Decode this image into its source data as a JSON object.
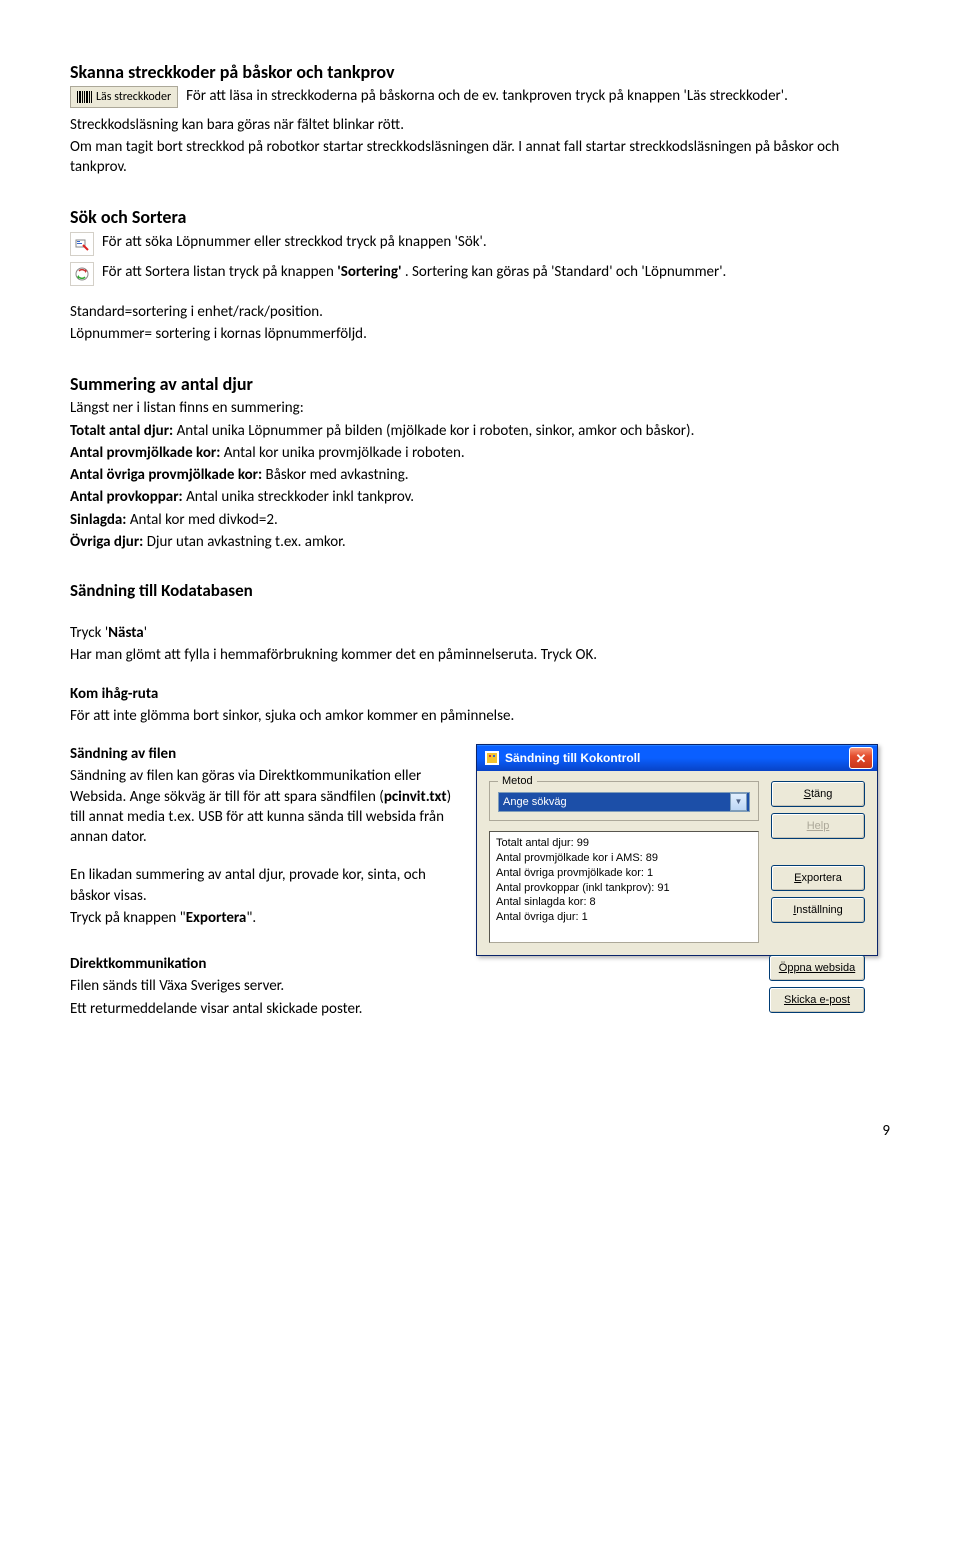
{
  "s1": {
    "title": "Skanna streckkoder på båskor och tankprov",
    "btn_label": "Läs streckkoder",
    "p1": "För att läsa in streckkoderna på båskorna och de ev. tankproven tryck på knappen 'Läs streckkoder'.",
    "p2": "Streckkodsläsning kan bara göras när fältet blinkar rött.",
    "p3": "Om man tagit bort streckkod på robotkor startar streckkodsläsningen där. I annat fall startar streckkodsläsningen på båskor och tankprov."
  },
  "s2": {
    "title": "Sök och Sortera",
    "row1": "För att söka Löpnummer eller streckkod tryck på knappen 'Sök'.",
    "row2a": "För att Sortera listan tryck på knappen ",
    "row2b": "'Sortering'",
    "row2c": " . Sortering kan göras på 'Standard'  och 'Löpnummer'.",
    "p1": "Standard=sortering i enhet/rack/position.",
    "p2": "Löpnummer= sortering i kornas löpnummerföljd."
  },
  "s3": {
    "title": "Summering av antal djur",
    "intro": "Längst ner i listan finns en summering:",
    "l1b": "Totalt antal djur:",
    "l1t": " Antal unika Löpnummer på bilden (mjölkade kor i roboten, sinkor, amkor och båskor).",
    "l2b": "Antal provmjölkade kor:",
    "l2t": " Antal kor unika provmjölkade i roboten.",
    "l3b": "Antal övriga provmjölkade kor:",
    "l3t": " Båskor med avkastning.",
    "l4b": "Antal provkoppar:",
    "l4t": " Antal unika streckkoder inkl tankprov.",
    "l5b": "Sinlagda:",
    "l5t": " Antal kor med divkod=2.",
    "l6b": "Övriga djur:",
    "l6t": " Djur utan avkastning t.ex. amkor."
  },
  "s4": {
    "title": "Sändning till Kodatabasen",
    "p1a": "Tryck '",
    "p1b": "Nästa",
    "p1c": "'",
    "p2": "Har man glömt att fylla i hemmaförbrukning kommer det en påminnelseruta. Tryck OK.",
    "h1": "Kom ihåg-ruta",
    "p3": "För att inte glömma bort sinkor, sjuka och amkor kommer en påminnelse.",
    "h2": "Sändning av filen",
    "p4a": "Sändning av filen kan göras via Direktkommunikation eller Websida. Ange sökväg är till för att spara sändfilen (",
    "p4b": "pcinvit.txt",
    "p4c": ") till annat media t.ex. USB för att kunna sända till websida från annan dator.",
    "p5": "En likadan summering av antal djur, provade kor, sinta, och båskor visas.",
    "p6a": "Tryck på knappen \"",
    "p6b": "Exportera",
    "p6c": "\".",
    "h3": "Direktkommunikation",
    "p7": "Filen sänds till Växa Sveriges server.",
    "p8": "Ett returmeddelande visar antal skickade poster."
  },
  "dialog": {
    "title": "Sändning till Kokontroll",
    "metod_label": "Metod",
    "dropdown_value": "Ange sökväg",
    "info_l1": "Totalt antal djur: 99",
    "info_l2": "Antal provmjölkade kor i AMS: 89",
    "info_l3": "Antal övriga provmjölkade kor: 1",
    "info_l4": "Antal provkoppar (inkl tankprov): 91",
    "info_l5": "Antal sinlagda kor: 8",
    "info_l6": "Antal övriga djur: 1",
    "btn_close": "Stäng",
    "btn_help": "Help",
    "btn_export": "Exportera",
    "btn_settings": "Inställning",
    "btn_web": "Öppna websida",
    "btn_email": "Skicka e-post"
  },
  "page_number": "9"
}
